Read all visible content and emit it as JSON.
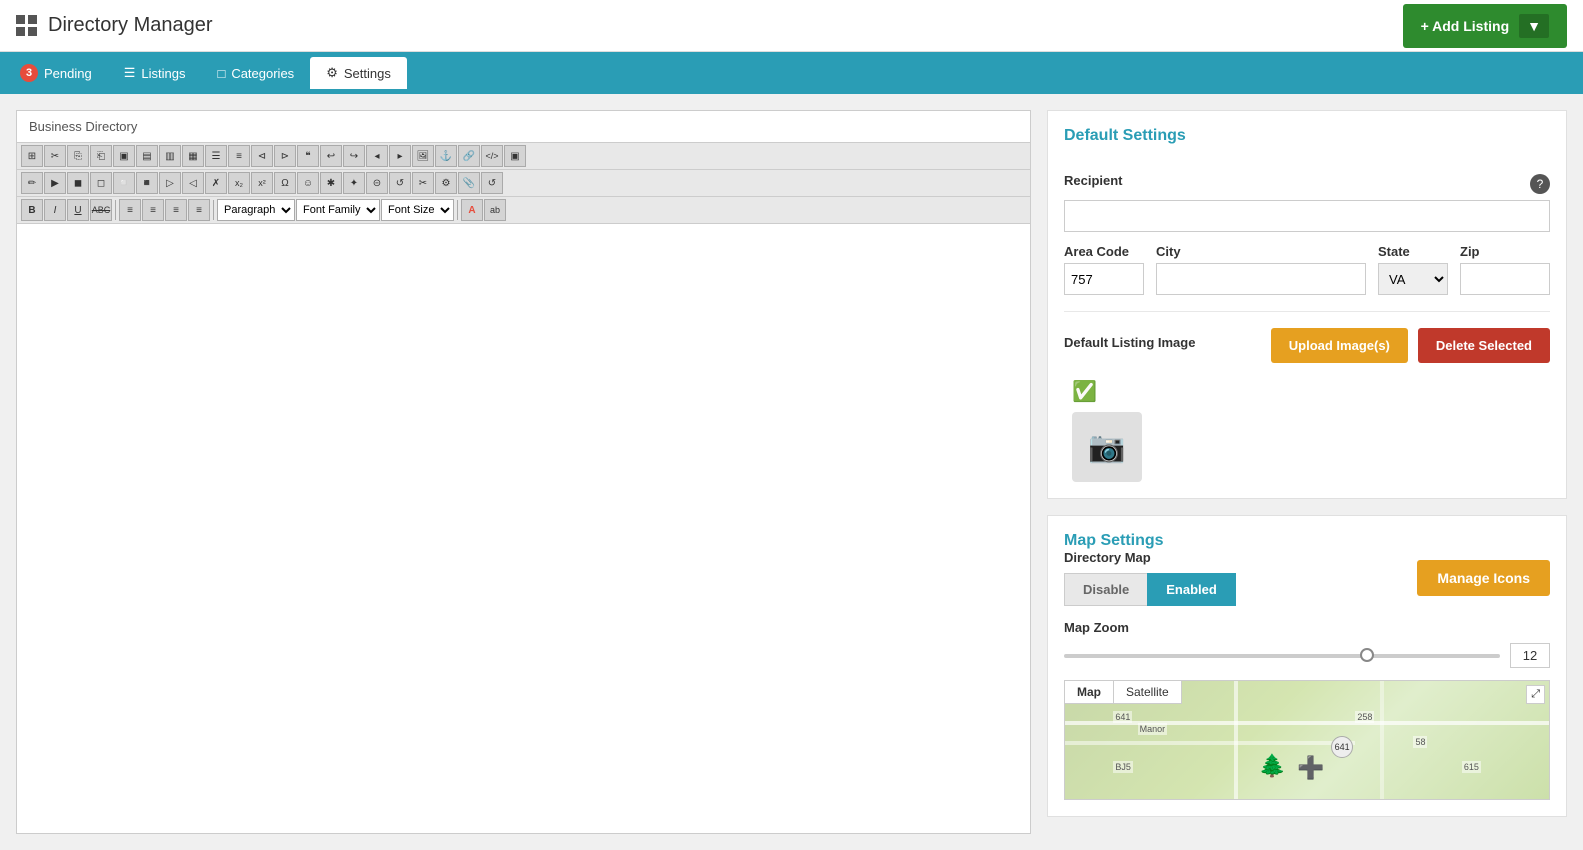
{
  "header": {
    "logo_alt": "grid-logo",
    "title": "Directory Manager",
    "add_listing_label": "+ Add Listing",
    "add_listing_arrow": "▼"
  },
  "nav": {
    "tabs": [
      {
        "id": "pending",
        "label": "Pending",
        "badge": "3",
        "icon": "⏰",
        "active": false
      },
      {
        "id": "listings",
        "label": "Listings",
        "icon": "☰",
        "active": false
      },
      {
        "id": "categories",
        "label": "Categories",
        "icon": "□",
        "active": false
      },
      {
        "id": "settings",
        "label": "Settings",
        "icon": "⚙",
        "active": true
      }
    ]
  },
  "editor": {
    "title": "Business Directory",
    "toolbar": {
      "row1": [
        "⊞",
        "✂",
        "⎘",
        "⎗",
        "⎝",
        "⎠",
        "Ω",
        "⚑",
        "❝",
        "❞",
        "◂",
        "⊲",
        "⊳",
        "⊴",
        "↩",
        "⊹",
        "⊺",
        "⊻",
        "⊼",
        "↓",
        "⚓",
        "🔗",
        "☰",
        "</>",
        "▣"
      ],
      "row2": [
        "✏",
        "▶",
        "◼",
        "⊕",
        "⊗",
        "✗",
        "x₂",
        "x²",
        "Ω",
        "☺",
        "⁂",
        "⁑",
        "✦",
        "⊝",
        "🔁",
        "✂",
        "⚙",
        "📎",
        "↺"
      ],
      "format_options": [
        "Paragraph"
      ],
      "font_family_options": [
        "Font Family"
      ],
      "font_size_options": [
        "Font Size"
      ]
    }
  },
  "default_settings": {
    "section_title": "Default Settings",
    "recipient_label": "Recipient",
    "recipient_value": "",
    "recipient_placeholder": "",
    "help_icon": "?",
    "area_code_label": "Area Code",
    "area_code_value": "757",
    "city_label": "City",
    "city_value": "",
    "state_label": "State",
    "state_value": "VA",
    "zip_label": "Zip",
    "zip_value": "",
    "default_listing_image_label": "Default Listing Image",
    "upload_btn_label": "Upload Image(s)",
    "delete_btn_label": "Delete Selected"
  },
  "map_settings": {
    "section_title": "Map Settings",
    "directory_map_label": "Directory Map",
    "disable_label": "Disable",
    "enabled_label": "Enabled",
    "manage_icons_label": "Manage Icons",
    "map_zoom_label": "Map Zoom",
    "map_zoom_value": "12",
    "map_tabs": [
      "Map",
      "Satellite"
    ],
    "active_map_tab": "Map"
  }
}
